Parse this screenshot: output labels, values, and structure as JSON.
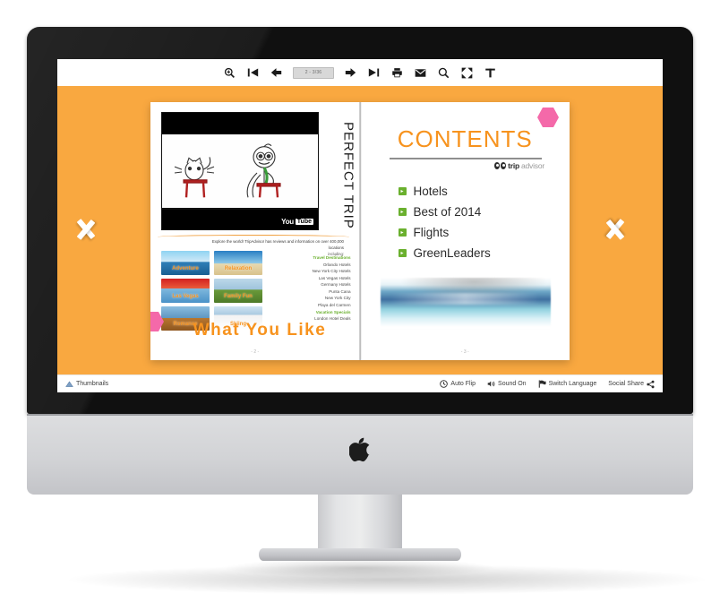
{
  "toolbar": {
    "icons": [
      {
        "name": "zoom-in-icon",
        "glyph": "search-plus"
      },
      {
        "name": "first-page-icon",
        "glyph": "skip-back"
      },
      {
        "name": "previous-page-icon",
        "glyph": "arrow-left"
      },
      {
        "name": "next-page-icon",
        "glyph": "arrow-right"
      },
      {
        "name": "last-page-icon",
        "glyph": "skip-forward"
      },
      {
        "name": "print-icon",
        "glyph": "printer"
      },
      {
        "name": "email-icon",
        "glyph": "envelope"
      },
      {
        "name": "search-icon",
        "glyph": "magnifier"
      },
      {
        "name": "fullscreen-icon",
        "glyph": "expand"
      },
      {
        "name": "text-select-icon",
        "glyph": "T"
      }
    ],
    "page_indicator": "2 - 3/36"
  },
  "viewer": {
    "background_color": "#f9a840",
    "previous_label": "Previous page",
    "next_label": "Next page"
  },
  "left_page": {
    "vertical_title": "PERFECT TRIP",
    "video": {
      "provider": "You",
      "badge": "Tube"
    },
    "intro": "Explore the world! TripAdvisor has reviews and information on over 400,000 locations",
    "including_label": "including:",
    "destinations": [
      {
        "label": "Travel Destinations",
        "highlight": true
      },
      {
        "label": "Orlando Hotels",
        "highlight": false
      },
      {
        "label": "New York City Hotels",
        "highlight": false
      },
      {
        "label": "Las Vegas Hotels",
        "highlight": false
      },
      {
        "label": "Germany Hotels",
        "highlight": false
      },
      {
        "label": "Punta Cana",
        "highlight": false
      },
      {
        "label": "New York City",
        "highlight": false
      },
      {
        "label": "Playa del Carmen",
        "highlight": false
      },
      {
        "label": "Vacation Specials",
        "highlight": true
      },
      {
        "label": "London Hotel Deals",
        "highlight": false
      }
    ],
    "thumbnails": [
      {
        "caption": "Adventure",
        "theme": "t-a"
      },
      {
        "caption": "Relaxation",
        "theme": "t-b"
      },
      {
        "caption": "Las Vegas",
        "theme": "t-c"
      },
      {
        "caption": "Family Fun",
        "theme": "t-d"
      },
      {
        "caption": "Romance",
        "theme": "t-e"
      },
      {
        "caption": "Skiing",
        "theme": "t-f"
      }
    ],
    "headline": "What You Like",
    "page_number": "- 2 -"
  },
  "right_page": {
    "title": "CONTENTS",
    "brand": {
      "bold": "trip",
      "light": "advisor"
    },
    "items": [
      {
        "label": "Hotels"
      },
      {
        "label": "Best of 2014"
      },
      {
        "label": "Flights"
      },
      {
        "label": "GreenLeaders"
      }
    ],
    "page_number": "- 3 -"
  },
  "statusbar": {
    "thumbnails_label": "Thumbnails",
    "auto_flip_label": "Auto Flip",
    "sound_label": "Sound On",
    "language_label": "Switch Language",
    "share_label": "Social Share"
  },
  "colors": {
    "accent_orange": "#f7931e",
    "viewer_orange": "#f9a840",
    "bullet_green": "#6ab02e",
    "hex_pink": "#f469a9"
  }
}
